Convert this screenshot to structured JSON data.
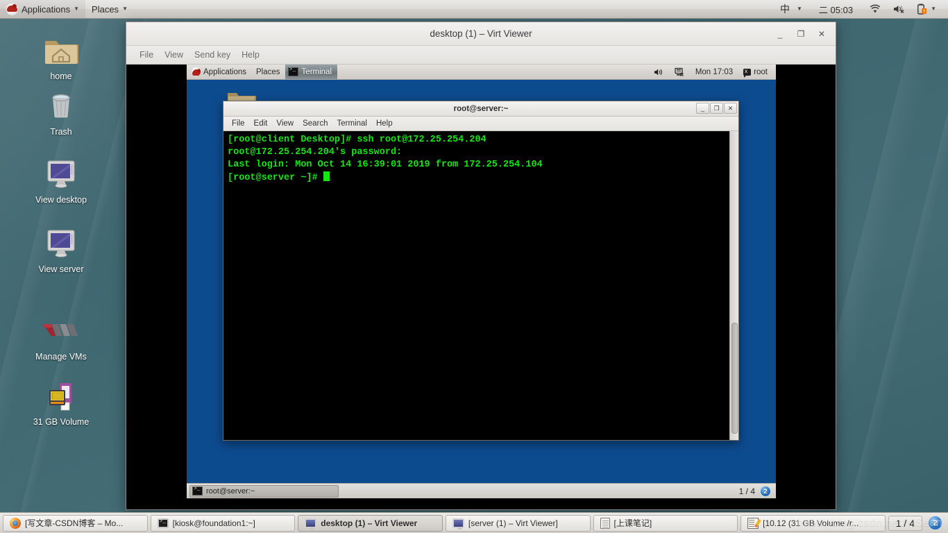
{
  "top_panel": {
    "applications": "Applications",
    "places": "Places",
    "ime": "中",
    "clock": "二 05:03",
    "icons": [
      "redhat-logo-icon",
      "wifi-icon",
      "volume-muted-icon",
      "battery-warning-icon",
      "chevron-down-icon"
    ]
  },
  "desktop_icons": [
    {
      "label": "home",
      "icon": "folder-home-icon"
    },
    {
      "label": "Trash",
      "icon": "trash-icon"
    },
    {
      "label": "View desktop",
      "icon": "monitor-icon"
    },
    {
      "label": "View server",
      "icon": "monitor-icon"
    },
    {
      "label": "Manage VMs",
      "icon": "vmware-logo-icon"
    },
    {
      "label": "31 GB Volume",
      "icon": "drive-volume-icon"
    }
  ],
  "virt_viewer": {
    "title": "desktop (1) – Virt Viewer",
    "menu": [
      "File",
      "View",
      "Send key",
      "Help"
    ],
    "window_buttons": {
      "minimize": "_",
      "maximize": "❐",
      "close": "✕"
    }
  },
  "vm": {
    "panel": {
      "applications": "Applications",
      "places": "Places",
      "active_task": "Terminal",
      "clock": "Mon 17:03",
      "user": "root"
    },
    "terminal": {
      "title": "root@server:~",
      "menu": [
        "File",
        "Edit",
        "View",
        "Search",
        "Terminal",
        "Help"
      ],
      "window_buttons": {
        "minimize": "_",
        "maximize": "❐",
        "close": "✕"
      },
      "lines": [
        "[root@client Desktop]# ssh root@172.25.254.204",
        "root@172.25.254.204's password:",
        "Last login: Mon Oct 14 16:39:01 2019 from 172.25.254.104",
        "[root@server ~]# "
      ],
      "fg_color": "#15e715",
      "bg_color": "#000000"
    },
    "taskbar": {
      "task": "root@server:~",
      "workspace": "1 / 4",
      "badge": "2"
    }
  },
  "host_taskbar": {
    "items": [
      {
        "label": "[写文章-CSDN博客 – Mo...",
        "icon": "firefox-icon",
        "active": false
      },
      {
        "label": "[kiosk@foundation1:~]",
        "icon": "terminal-icon",
        "active": false
      },
      {
        "label": "desktop (1) – Virt Viewer",
        "icon": "monitor-icon",
        "active": true
      },
      {
        "label": "[server (1) – Virt Viewer]",
        "icon": "monitor-icon",
        "active": false
      },
      {
        "label": "[上课笔记]",
        "icon": "notes-icon",
        "active": false
      },
      {
        "label": "[10.12 (31 GB Volume /r...",
        "icon": "pencil-note-icon",
        "active": false
      }
    ],
    "workspace": "1 / 4",
    "badge": "2"
  },
  "watermark": "https://blog.csdn.net/YiSean"
}
